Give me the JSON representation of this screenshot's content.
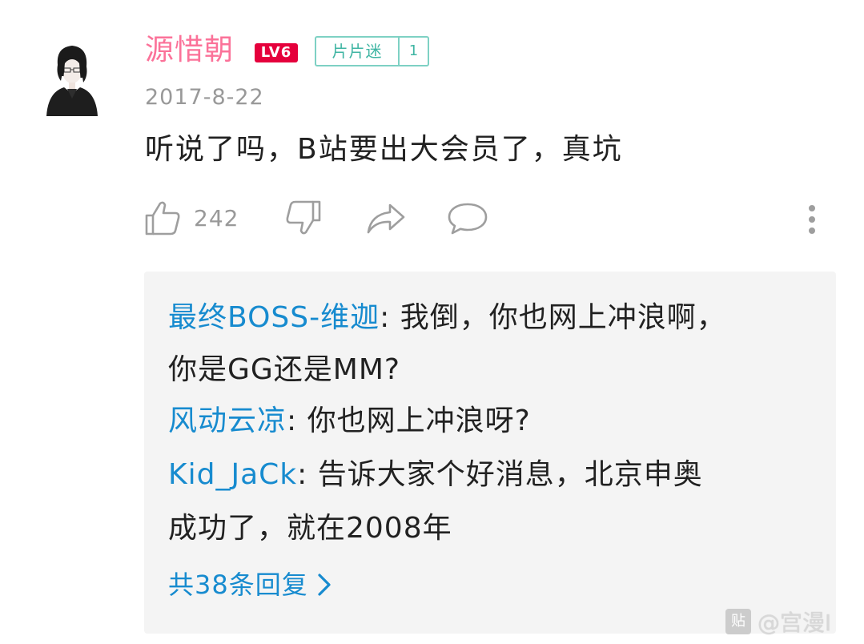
{
  "comment": {
    "username": "源惜朝",
    "level_badge": "LV6",
    "medal": {
      "name": "片片迷",
      "level": "1"
    },
    "timestamp": "2017-8-22",
    "content": "听说了吗，B站要出大会员了，真坑",
    "actions": {
      "like_count": "242",
      "like_icon": "thumb-up-icon",
      "dislike_icon": "thumb-down-icon",
      "share_icon": "share-icon",
      "reply_icon": "comment-bubble-icon",
      "more_icon": "more-vertical-icon"
    }
  },
  "replies": {
    "items": [
      {
        "user": "最终BOSS-维迦",
        "separator": ": ",
        "text_line1": "我倒，你也网上冲浪啊，",
        "text_line2": "你是GG还是MM?"
      },
      {
        "user": "风动云凉",
        "separator": ": ",
        "text_line1": "你也网上冲浪呀?"
      },
      {
        "user": "Kid_JaCk",
        "separator": ": ",
        "text_line1": "告诉大家个好消息，北京申奥",
        "text_line2": "成功了，就在2008年"
      }
    ],
    "more_label": "共38条回复"
  },
  "watermark": {
    "logo": "贴",
    "text": "@宫漫I"
  },
  "colors": {
    "username": "#fb7299",
    "level_badge": "#e5003c",
    "medal": "#3fb5a3",
    "reply_user": "#178bcf",
    "reply_bg": "#f4f4f4",
    "meta": "#999999"
  }
}
